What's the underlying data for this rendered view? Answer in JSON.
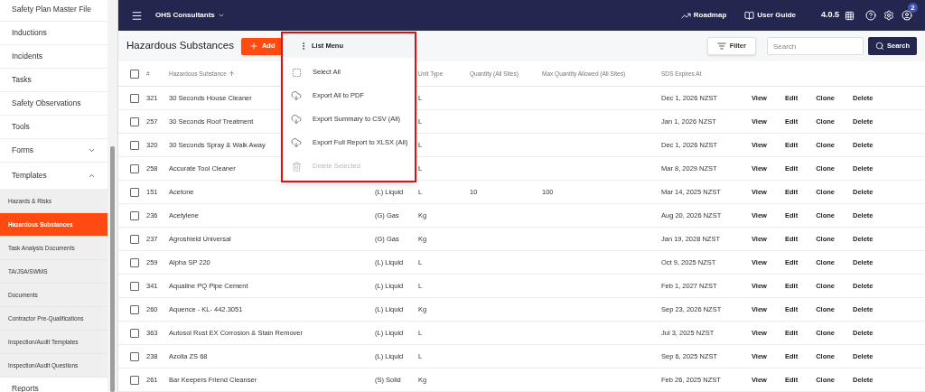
{
  "sidebar": {
    "items": [
      {
        "label": "Safety Plan Master File"
      },
      {
        "label": "Inductions"
      },
      {
        "label": "Incidents"
      },
      {
        "label": "Tasks"
      },
      {
        "label": "Safety Observations"
      },
      {
        "label": "Tools"
      },
      {
        "label": "Forms",
        "expanded": false
      },
      {
        "label": "Templates",
        "expanded": true,
        "children": [
          {
            "label": "Hazards & Risks",
            "selected": false
          },
          {
            "label": "Hazardous Substances",
            "selected": true
          },
          {
            "label": "Task Analysis Documents",
            "selected": false
          },
          {
            "label": "TA/JSA/SWMS",
            "selected": false
          },
          {
            "label": "Documents",
            "selected": false
          },
          {
            "label": "Contractor Pre-Qualifications",
            "selected": false
          },
          {
            "label": "Inspection/Audit Templates",
            "selected": false
          },
          {
            "label": "Inspection/Audit Questions",
            "selected": false
          }
        ]
      },
      {
        "label": "Reports"
      }
    ]
  },
  "topbar": {
    "organization": "OHS Consultants",
    "links": [
      "Roadmap",
      "User Guide"
    ],
    "version": "4.0.5",
    "notification_count": "2"
  },
  "page": {
    "title": "Hazardous Substances",
    "add_button": "Add",
    "filter_button": "Filter",
    "search": {
      "placeholder": "Search"
    },
    "search_button": "Search"
  },
  "list_menu": {
    "title": "List Menu",
    "items": [
      {
        "label": "Select All",
        "kind": "select",
        "disabled": false
      },
      {
        "label": "Export All to PDF",
        "kind": "export",
        "disabled": false
      },
      {
        "label": "Export Summary to CSV (All)",
        "kind": "export",
        "disabled": false
      },
      {
        "label": "Export Full Report to XLSX (All)",
        "kind": "export",
        "disabled": false
      },
      {
        "label": "Delete Selected",
        "kind": "delete",
        "disabled": true
      }
    ]
  },
  "table": {
    "columns": [
      {
        "label": "#"
      },
      {
        "label": "Hazardous Substance",
        "sorted": true
      },
      {},
      {
        "label": "Unit Type"
      },
      {
        "label": "Quantity (All Sites)"
      },
      {
        "label": "Max Quantity Allowed (All Sites)"
      },
      {
        "label": "SDS Expires At"
      }
    ],
    "select_all_checked": false,
    "rows": [
      {
        "checked": false,
        "id": "321",
        "name": "30 Seconds House Cleaner",
        "unit": "L",
        "sds_expires": "Dec 1, 2026 NZST",
        "actions": [
          "View",
          "Edit",
          "Clone",
          "Delete"
        ]
      },
      {
        "checked": false,
        "id": "257",
        "name": "30 Seconds Roof Treatment",
        "unit": "L",
        "sds_expires": "Jan 1, 2026 NZST",
        "actions": [
          "View",
          "Edit",
          "Clone",
          "Delete"
        ]
      },
      {
        "checked": false,
        "id": "320",
        "name": "30 Seconds Spray & Walk Away",
        "unit": "L",
        "sds_expires": "Dec 1, 2026 NZST",
        "actions": [
          "View",
          "Edit",
          "Clone",
          "Delete"
        ]
      },
      {
        "checked": false,
        "id": "258",
        "name": "Accurate Tool Cleaner",
        "unit": "L",
        "sds_expires": "Mar 8, 2029 NZST",
        "actions": [
          "View",
          "Edit",
          "Clone",
          "Delete"
        ]
      },
      {
        "checked": false,
        "id": "151",
        "name": "Acetone",
        "state": "(L) Liquid",
        "unit": "L",
        "quantity": "10",
        "max_quantity": "100",
        "sds_expires": "Mar 14, 2025 NZST",
        "actions": [
          "View",
          "Edit",
          "Clone",
          "Delete"
        ]
      },
      {
        "checked": false,
        "id": "236",
        "name": "Acetylene",
        "state": "(G) Gas",
        "unit": "Kg",
        "sds_expires": "Aug 20, 2026 NZST",
        "actions": [
          "View",
          "Edit",
          "Clone",
          "Delete"
        ]
      },
      {
        "checked": false,
        "id": "237",
        "name": "Agroshield Universal",
        "state": "(G) Gas",
        "unit": "Kg",
        "sds_expires": "Jan 19, 2028 NZST",
        "actions": [
          "View",
          "Edit",
          "Clone",
          "Delete"
        ]
      },
      {
        "checked": false,
        "id": "259",
        "name": "Alpha SP 220",
        "state": "(L) Liquid",
        "unit": "L",
        "sds_expires": "Oct 9, 2025 NZST",
        "actions": [
          "View",
          "Edit",
          "Clone",
          "Delete"
        ]
      },
      {
        "checked": false,
        "id": "341",
        "name": "Aqualine PQ Pipe Cement",
        "state": "(L) Liquid",
        "unit": "L",
        "sds_expires": "Feb 1, 2027 NZST",
        "actions": [
          "View",
          "Edit",
          "Clone",
          "Delete"
        ]
      },
      {
        "checked": false,
        "id": "260",
        "name": "Aquence - KL- 442.3051",
        "state": "(L) Liquid",
        "unit": "Kg",
        "sds_expires": "Sep 23, 2026 NZST",
        "actions": [
          "View",
          "Edit",
          "Clone",
          "Delete"
        ]
      },
      {
        "checked": false,
        "id": "363",
        "name": "Autosol Rust EX Corrosion & Stain Remover",
        "state": "(L) Liquid",
        "unit": "L",
        "sds_expires": "Jul 3, 2025 NZST",
        "actions": [
          "View",
          "Edit",
          "Clone",
          "Delete"
        ]
      },
      {
        "checked": false,
        "id": "238",
        "name": "Azolla ZS 68",
        "state": "(L) Liquid",
        "unit": "L",
        "sds_expires": "Sep 6, 2025 NZST",
        "actions": [
          "View",
          "Edit",
          "Clone",
          "Delete"
        ]
      },
      {
        "checked": false,
        "id": "261",
        "name": "Bar Keepers Friend Cleanser",
        "state": "(S) Solid",
        "unit": "Kg",
        "sds_expires": "Feb 26, 2025 NZST",
        "actions": [
          "View",
          "Edit",
          "Clone",
          "Delete"
        ]
      }
    ]
  }
}
